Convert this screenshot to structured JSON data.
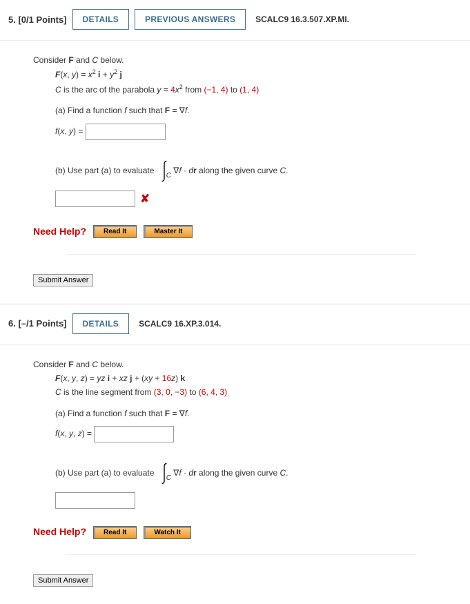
{
  "questions": [
    {
      "number": "5.",
      "points": "[0/1 Points]",
      "details_label": "DETAILS",
      "prev_label": "PREVIOUS ANSWERS",
      "source": "SCALC9 16.3.507.XP.MI.",
      "intro": "Consider F and C below.",
      "eq_lhs": "F",
      "eq_args": "(x, y) = ",
      "arc_prefix": "C is the arc of the parabola ",
      "arc_eq_lhs": "y = ",
      "arc_factor": "4",
      "arc_eq_var": "x",
      "arc_from": " from ",
      "pt1": "(−1, 4)",
      "arc_to": " to ",
      "pt2": "(1, 4)",
      "part_a": "(a) Find a function f such that F = ∇f.",
      "fxy_label": "f(x, y) = ",
      "part_b_pre": "(b) Use part (a) to evaluate ",
      "part_b_post": "∇f · dr along the given curve C.",
      "need_help": "Need Help?",
      "help_btns": [
        "Read It",
        "Master It"
      ],
      "submit": "Submit Answer"
    },
    {
      "number": "6.",
      "points": "[–/1 Points]",
      "details_label": "DETAILS",
      "source": "SCALC9 16.XP.3.014.",
      "intro": "Consider F and C below.",
      "eq_lhs": "F",
      "eq_args": "(x, y, z) = ",
      "eq_body1": "yz i + xz j + (xy + ",
      "eq_16": "16",
      "eq_body2": "z) k",
      "line_prefix": "C is the line segment from ",
      "pt1": "(3, 0, −3)",
      "line_to": " to ",
      "pt2": "(6, 4, 3)",
      "part_a": "(a) Find a function f such that F = ∇f.",
      "fxy_label": "f(x, y, z) = ",
      "part_b_pre": "(b) Use part (a) to evaluate ",
      "part_b_post": "∇f · dr along the given curve C.",
      "need_help": "Need Help?",
      "help_btns": [
        "Read It",
        "Watch It"
      ],
      "submit": "Submit Answer"
    }
  ]
}
